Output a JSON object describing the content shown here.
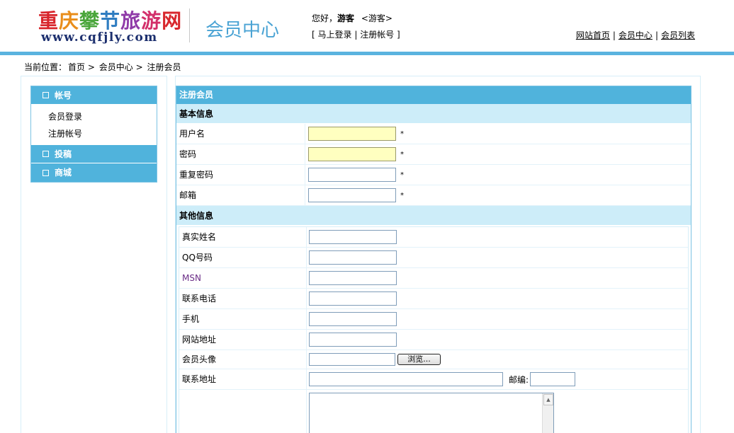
{
  "header": {
    "logo_cn_chars": [
      "重",
      "庆",
      "攀",
      "节",
      "旅",
      "游",
      "网"
    ],
    "logo_en": "www.cqfjly.com",
    "member_center": "会员中心",
    "greeting_prefix": "您好，",
    "greeting_user": "游客",
    "greeting_role": "<游客>",
    "login_link": "马上登录",
    "register_link": "注册帐号",
    "nav": [
      "网站首页",
      "会员中心",
      "会员列表"
    ]
  },
  "breadcrumb": {
    "prefix": "当前位置：",
    "items": [
      "首页",
      "会员中心",
      "注册会员"
    ]
  },
  "sidebar": {
    "account": {
      "title": "帐号",
      "items": [
        "会员登录",
        "注册帐号"
      ]
    },
    "submit": {
      "title": "投稿"
    },
    "shop": {
      "title": "商城"
    }
  },
  "form": {
    "title": "注册会员",
    "basic_title": "基本信息",
    "basic": [
      {
        "label": "用户名",
        "required": "*"
      },
      {
        "label": "密码",
        "required": "*"
      },
      {
        "label": "重复密码",
        "required": "*"
      },
      {
        "label": "邮箱",
        "required": "*"
      }
    ],
    "other_title": "其他信息",
    "other": [
      {
        "label": "真实姓名"
      },
      {
        "label": "QQ号码"
      },
      {
        "label": "MSN"
      },
      {
        "label": "联系电话"
      },
      {
        "label": "手机"
      },
      {
        "label": "网站地址"
      },
      {
        "label": "会员头像"
      },
      {
        "label": "联系地址"
      }
    ],
    "browse_label": "浏览...",
    "zip_label": "邮编:"
  },
  "colors": {
    "accent_blue": "#50b3dc",
    "section_bg": "#cdedf9",
    "required_field_bg": "#ffffc0"
  }
}
